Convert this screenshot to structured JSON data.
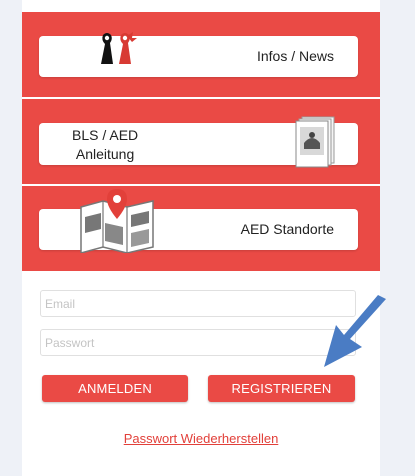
{
  "menu": {
    "infos_label": "Infos / News",
    "bls_line1": "BLS / AED",
    "bls_line2": "Anleitung",
    "aed_label": "AED Standorte"
  },
  "login": {
    "email_placeholder": "Email",
    "password_placeholder": "Passwort",
    "login_label": "ANMELDEN",
    "register_label": "REGISTRIEREN",
    "reset_label": "Passwort Wiederherstellen"
  },
  "colors": {
    "brand_red": "#ea4a45",
    "arrow_blue": "#4a7cc4"
  },
  "icons": [
    "baselstab-icon",
    "booklet-icon",
    "map-pin-icon",
    "arrow-icon"
  ]
}
